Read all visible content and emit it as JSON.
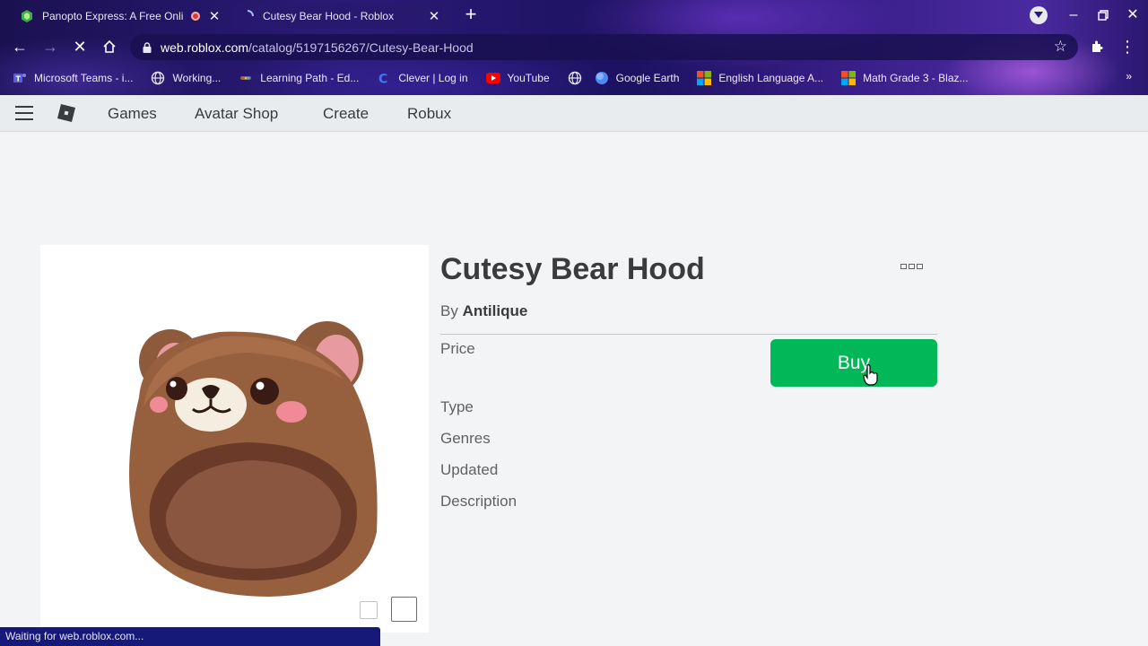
{
  "browser": {
    "tabs": [
      {
        "title": "Panopto Express: A Free Onli",
        "recording": true,
        "active": false
      },
      {
        "title": "Cutesy Bear Hood - Roblox",
        "active": true
      }
    ],
    "url_host": "web.roblox.com",
    "url_path": "/catalog/5197156267/Cutesy-Bear-Hood",
    "bookmarks": [
      {
        "label": "Microsoft Teams - i...",
        "icon": "teams-icon"
      },
      {
        "label": "Working...",
        "icon": "globe-icon"
      },
      {
        "label": "Learning Path - Ed...",
        "icon": "edgenuity-icon"
      },
      {
        "label": "Clever | Log in",
        "icon": "clever-icon"
      },
      {
        "label": "YouTube",
        "icon": "youtube-icon"
      },
      {
        "label": "",
        "icon": "globe-icon"
      },
      {
        "label": "Google Earth",
        "icon": "google-earth-icon"
      },
      {
        "label": "English Language A...",
        "icon": "microsoft-icon"
      },
      {
        "label": "Math Grade 3 - Blaz...",
        "icon": "microsoft-icon"
      }
    ],
    "more_bookmarks": "»",
    "status_text": "Waiting for web.roblox.com..."
  },
  "nav": {
    "links": [
      "Games",
      "Avatar Shop",
      "Create",
      "Robux"
    ]
  },
  "item": {
    "title": "Cutesy Bear Hood",
    "by_prefix": "By",
    "creator": "Antilique",
    "buy_label": "Buy",
    "fields": [
      "Price",
      "Type",
      "Genres",
      "Updated",
      "Description"
    ]
  },
  "colors": {
    "buy_button": "#02b757",
    "text_primary": "#393b3d",
    "page_background": "#f2f4f5"
  }
}
